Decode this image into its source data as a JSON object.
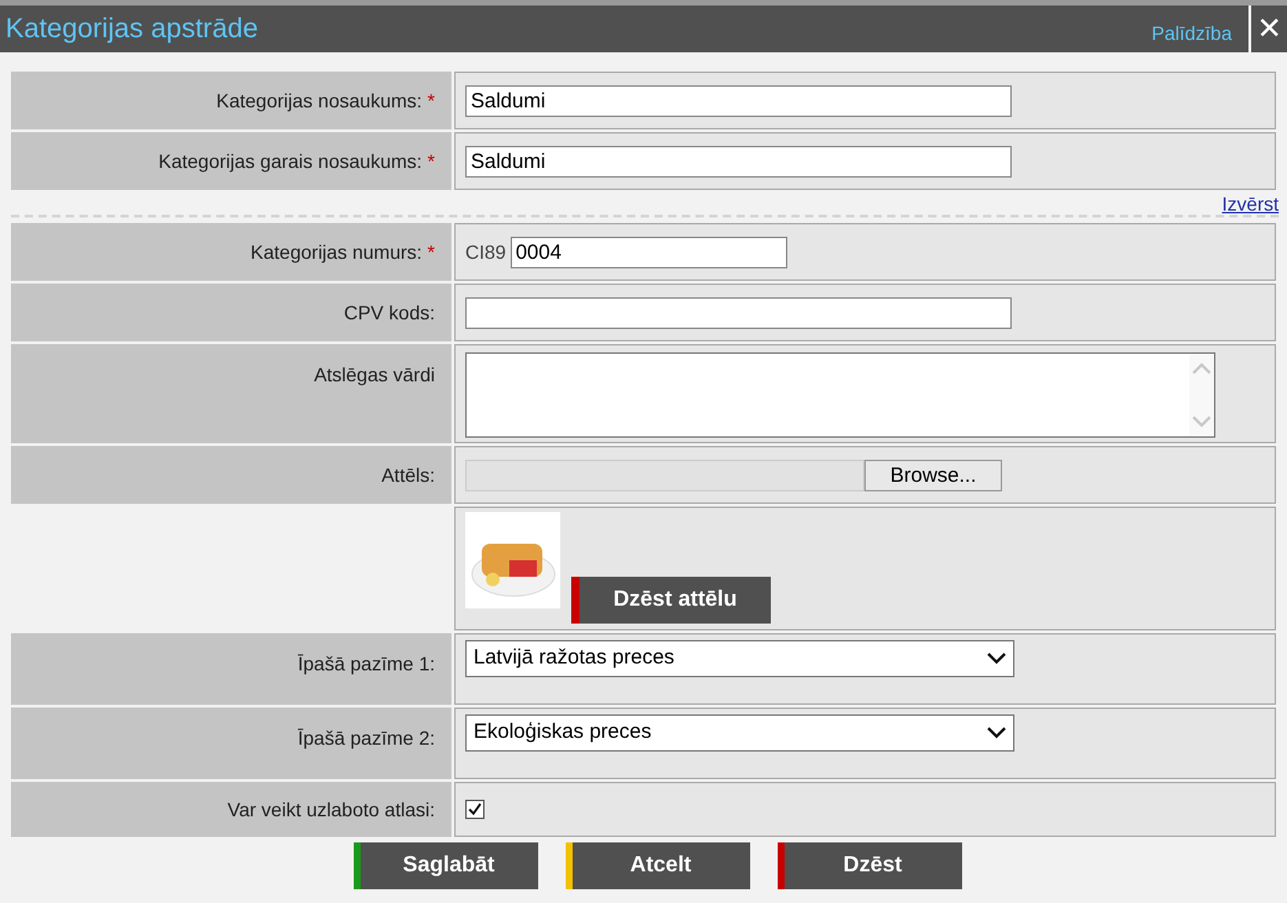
{
  "window": {
    "title": "Kategorijas apstrāde",
    "help_link": "Palīdzība",
    "close": "✕"
  },
  "sections": [
    {
      "rows": [
        {
          "kind": "text",
          "label": "Kategorijas nosaukums:",
          "required_mark": "*",
          "value": "Saldumi"
        },
        {
          "kind": "text",
          "label": "Kategorijas garais nosaukums:",
          "required_mark": "*",
          "value": "Saldumi"
        }
      ]
    },
    {
      "expand_link": "Izvērst",
      "rows": [
        {
          "kind": "prefixed",
          "label": "Kategorijas numurs:",
          "required_mark": "*",
          "prefix": "CI89",
          "value": "0004"
        },
        {
          "kind": "text",
          "label": "CPV kods:"
        },
        {
          "kind": "textarea",
          "label": "Atslēgas vārdi"
        },
        {
          "kind": "file",
          "label": "Attēls:",
          "button": "Browse..."
        },
        {
          "kind": "image",
          "button": "Dzēst attēlu"
        },
        {
          "kind": "select",
          "label": "Īpašā pazīme 1:",
          "value": "Latvijā ražotas preces"
        },
        {
          "kind": "select",
          "label": "Īpašā pazīme 2:",
          "value": "Ekoloģiskas preces"
        },
        {
          "kind": "checkbox",
          "label": "Var veikt uzlaboto atlasi:",
          "checked": true
        }
      ]
    }
  ],
  "buttons": [
    {
      "label": "Saglabāt",
      "color": "#1a9a1a"
    },
    {
      "label": "Atcelt",
      "color": "#f2c200"
    },
    {
      "label": "Dzēst",
      "color": "#c80000"
    }
  ]
}
